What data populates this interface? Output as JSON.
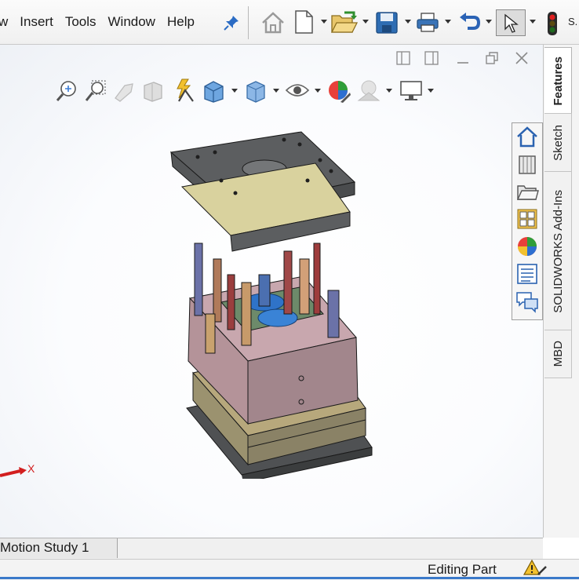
{
  "menu": {
    "items": [
      "w",
      "Insert",
      "Tools",
      "Window",
      "Help"
    ]
  },
  "toolbar": {
    "icons": [
      "home-icon",
      "new-document-icon",
      "open-folder-icon",
      "save-icon",
      "print-icon",
      "undo-icon",
      "select-pointer-icon",
      "rebuild-traffic-light-icon"
    ],
    "user_label": "S."
  },
  "window_controls": [
    "tile-left-icon",
    "tile-right-icon",
    "minimize-icon",
    "restore-icon",
    "close-icon"
  ],
  "heads_up_toolbar": [
    "zoom-to-fit-icon",
    "zoom-to-area-icon",
    "previous-view-icon",
    "section-view-icon",
    "dynamic-annotation-icon",
    "view-orientation-icon",
    "display-style-icon",
    "hide-show-items-icon",
    "edit-appearance-icon",
    "apply-scene-icon",
    "view-settings-icon"
  ],
  "task_pane": {
    "tabs": [
      {
        "label": "Features",
        "active": true
      },
      {
        "label": "Sketch",
        "active": false
      },
      {
        "label": "SOLIDWORKS Add-Ins",
        "active": false
      },
      {
        "label": "MBD",
        "active": false
      }
    ],
    "icons": [
      "solidworks-resources-home-icon",
      "design-library-icon",
      "file-explorer-folder-icon",
      "view-palette-icon",
      "appearances-scenes-icon",
      "custom-properties-icon",
      "solidworks-forum-icon"
    ]
  },
  "triad": {
    "axis_label": "X"
  },
  "bottom_tabs": {
    "motion_study": "Motion Study 1"
  },
  "status": {
    "text": "Editing Part"
  }
}
